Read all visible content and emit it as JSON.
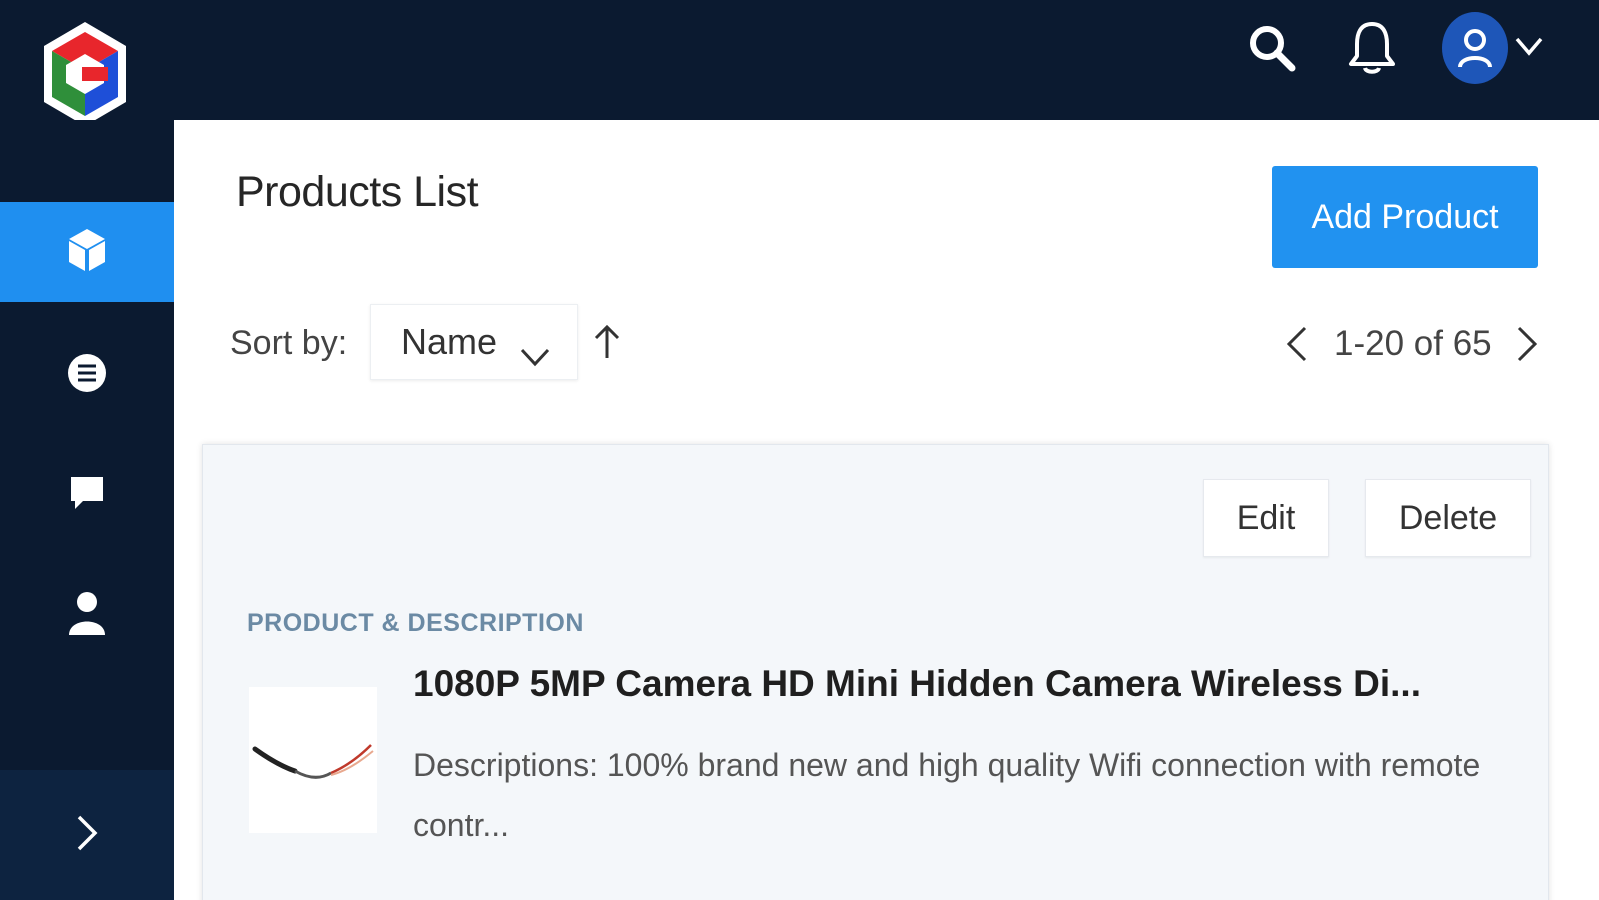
{
  "header": {
    "logo_name": "app-logo",
    "icons": [
      "search-icon",
      "bell-icon",
      "user-icon",
      "chevron-down-icon"
    ]
  },
  "sidebar": {
    "items": [
      {
        "icon": "cube-icon",
        "active": true
      },
      {
        "icon": "list-icon",
        "active": false
      },
      {
        "icon": "chat-icon",
        "active": false
      },
      {
        "icon": "user-icon",
        "active": false
      }
    ],
    "expand_icon": "chevron-right-icon"
  },
  "main": {
    "title": "Products List",
    "add_button": "Add Product",
    "sort": {
      "label": "Sort by:",
      "selected": "Name",
      "direction": "ascending"
    },
    "pagination": {
      "text": "1-20 of 65"
    },
    "card": {
      "edit_label": "Edit",
      "delete_label": "Delete",
      "column_header": "PRODUCT & DESCRIPTION",
      "product": {
        "name": "1080P 5MP Camera HD Mini Hidden Camera Wireless Di...",
        "description": "Descriptions: 100% brand new and high quality Wifi connection with remote contr..."
      }
    }
  },
  "colors": {
    "navy": "#0b1a30",
    "accent": "#1f8ff0",
    "label_blue": "#6b8aa4"
  }
}
